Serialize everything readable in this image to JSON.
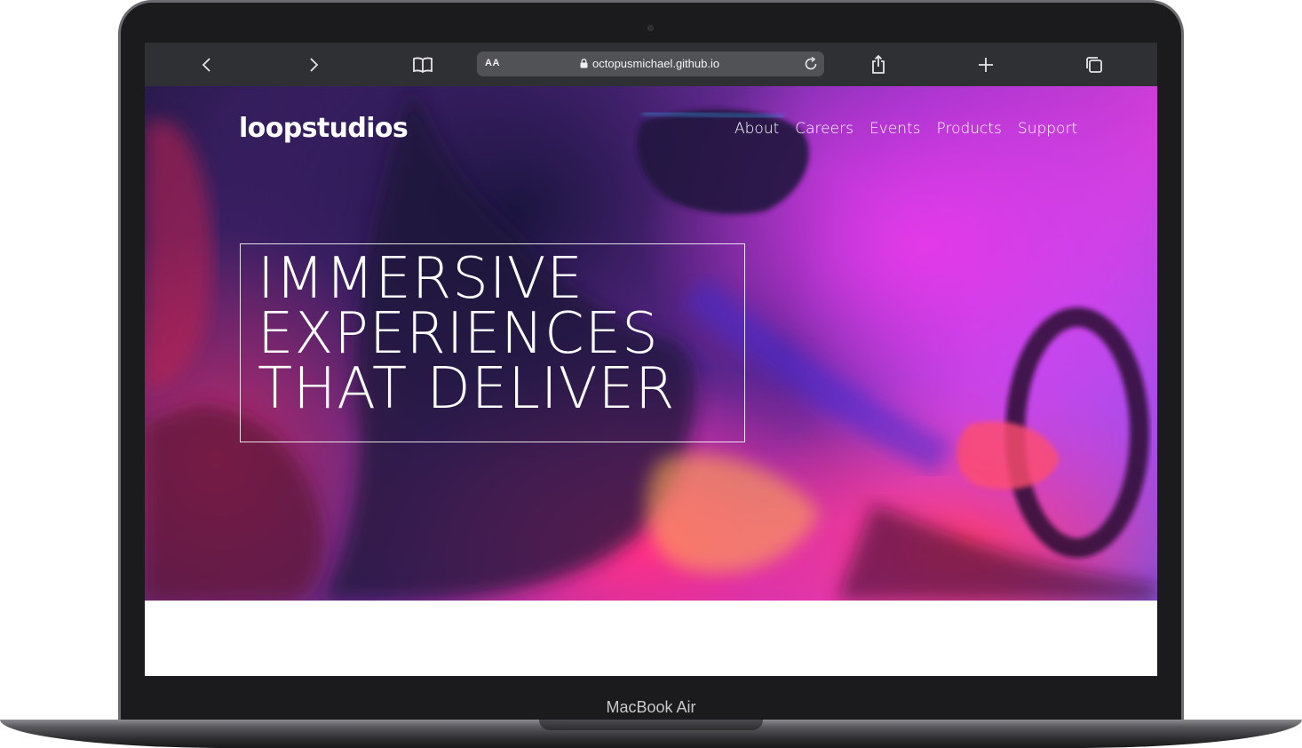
{
  "device": {
    "model_label": "MacBook Air"
  },
  "browser": {
    "text_size_button": "AA",
    "url": "octopusmichael.github.io",
    "icons": {
      "back": "chevron-left-icon",
      "forward": "chevron-right-icon",
      "bookmarks": "book-icon",
      "lock": "lock-icon",
      "reload": "reload-icon",
      "share": "share-icon",
      "new_tab": "plus-icon",
      "tabs": "tabs-icon"
    }
  },
  "page": {
    "brand": "loopstudios",
    "nav": {
      "about": "About",
      "careers": "Careers",
      "events": "Events",
      "products": "Products",
      "support": "Support"
    },
    "headline": {
      "line1": "IMMERSIVE",
      "line2": "EXPERIENCES",
      "line3": "THAT DELIVER"
    },
    "colors": {
      "hero_magenta": "#e33ae8",
      "hero_pink": "#ff2f86",
      "hero_violet": "#5b2a8c",
      "text": "#ffffff"
    }
  }
}
